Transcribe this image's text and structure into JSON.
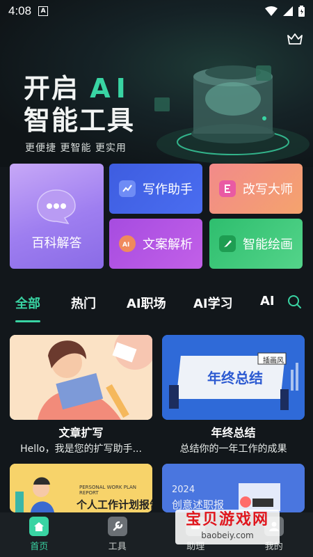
{
  "status": {
    "time": "4:08",
    "a_icon": "A"
  },
  "hero": {
    "title_line1_prefix": "开启",
    "title_line1_ai": "AI",
    "title_line2": "智能工具",
    "subtitle": "更便捷 更智能 更实用"
  },
  "features": {
    "big": "百科解答",
    "items": [
      "写作助手",
      "改写大师",
      "文案解析",
      "智能绘画"
    ]
  },
  "tabs": [
    "全部",
    "热门",
    "AI职场",
    "AI学习",
    "AI"
  ],
  "cards": [
    {
      "title": "文章扩写",
      "desc": "Hello，我是您的扩写助手..."
    },
    {
      "title": "年终总结",
      "desc": "总结你的一年工作的成果",
      "tag": "插画风",
      "img_text": "年终总结"
    },
    {
      "title": "",
      "desc": "",
      "img_text": "个人工作计划报告",
      "img_small": "PERSONAL WORK PLAN REPORT"
    },
    {
      "title": "",
      "desc": "",
      "img_text": "创意述职报",
      "img_small": "2024"
    }
  ],
  "nav": [
    {
      "label": "首页",
      "icon": "home-icon"
    },
    {
      "label": "工具",
      "icon": "wrench-icon"
    },
    {
      "label": "助理",
      "icon": "assistant-icon"
    },
    {
      "label": "我的",
      "icon": "user-icon"
    }
  ],
  "watermark": {
    "main": "宝贝游戏网",
    "url": "baobeiy.com"
  },
  "colors": {
    "accent": "#39d4a3",
    "background": "#12171b"
  }
}
